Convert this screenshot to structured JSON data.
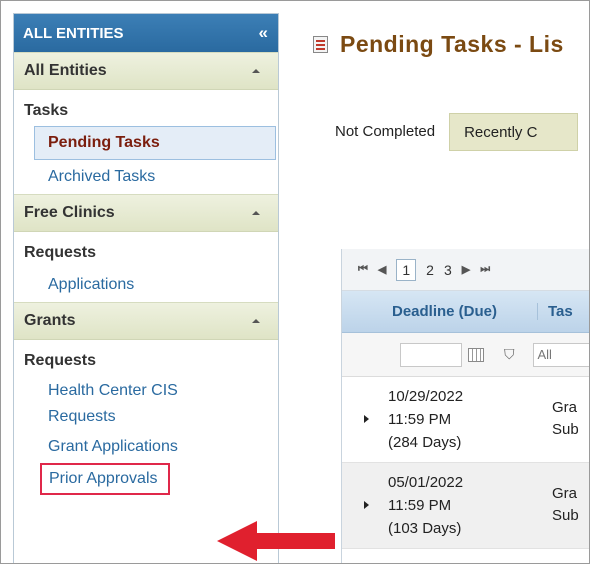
{
  "sidebar": {
    "header": "ALL ENTITIES",
    "collapse_glyph": "«",
    "sections": [
      {
        "title": "All Entities"
      },
      {
        "title": "Free Clinics"
      },
      {
        "title": "Grants"
      }
    ],
    "tasks_group": "Tasks",
    "tasks_links": [
      "Pending Tasks",
      "Archived Tasks"
    ],
    "free_clinics_group": "Requests",
    "free_clinics_links": [
      "Applications"
    ],
    "grants_group": "Requests",
    "grants_links": [
      "Health Center CIS Requests",
      "Grant Applications",
      "Prior Approvals"
    ]
  },
  "main": {
    "title": "Pending Tasks - Lis",
    "tabs": [
      {
        "label": "Not Completed"
      },
      {
        "label": "Recently C"
      }
    ],
    "pager": {
      "pages": [
        "1",
        "2",
        "3"
      ]
    },
    "columns": [
      "Deadline (Due)",
      "Tas"
    ],
    "filter_placeholder": "All",
    "rows": [
      {
        "deadline_date": "10/29/2022",
        "deadline_time": "11:59 PM",
        "deadline_days": "(284 Days)",
        "task_1": "Gra",
        "task_2": "Sub"
      },
      {
        "deadline_date": "05/01/2022",
        "deadline_time": "11:59 PM",
        "deadline_days": "(103 Days)",
        "task_1": "Gra",
        "task_2": "Sub"
      }
    ]
  },
  "colors": {
    "header_blue": "#2a6aa0",
    "section_bg": "#dfe4c6",
    "link_blue": "#2a6aa0",
    "title_brown": "#7b4a12",
    "highlight_red": "#e0284a"
  },
  "icons": [
    "collapse-icon",
    "caret-up-icon",
    "task-list-icon",
    "first-page-icon",
    "prev-page-icon",
    "next-page-icon",
    "last-page-icon",
    "calendar-icon",
    "filter-icon",
    "expand-row-icon",
    "red-arrow-icon"
  ]
}
